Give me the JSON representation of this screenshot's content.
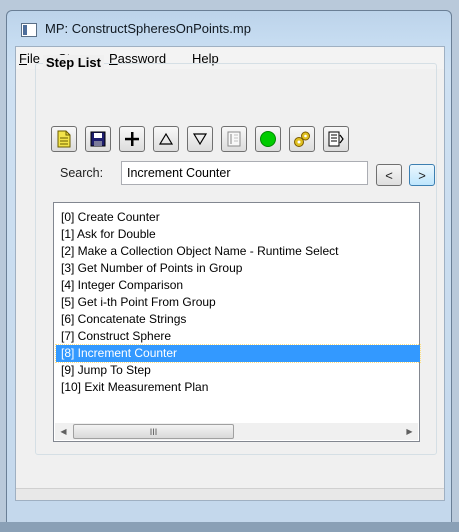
{
  "window": {
    "title": "MP: ConstructSpheresOnPoints.mp"
  },
  "menu": [
    {
      "accel": "F",
      "rest": "ile"
    },
    {
      "accel": "S",
      "rest": "tep"
    },
    {
      "accel": "P",
      "rest": "assword"
    },
    {
      "accel": "",
      "rest": "Help"
    }
  ],
  "step_list": {
    "group_label": "Step List",
    "toolbar": [
      {
        "name": "new-step-icon",
        "color": "#f2e34a"
      },
      {
        "name": "save-icon",
        "color": "#1e1e6e"
      },
      {
        "name": "add-icon",
        "color": "#000000"
      },
      {
        "name": "move-up-icon",
        "color": "#000000"
      },
      {
        "name": "move-down-icon",
        "color": "#000000"
      },
      {
        "name": "notes-icon",
        "color": "#bfbfbf"
      },
      {
        "name": "run-icon",
        "color": "#00cc00"
      },
      {
        "name": "gears-icon",
        "color": "#e0c020"
      },
      {
        "name": "properties-icon",
        "color": "#000000"
      }
    ],
    "search": {
      "label": "Search:",
      "value": "Increment Counter",
      "prev_label": "<",
      "next_label": ">"
    },
    "items": [
      "[0] Create Counter",
      "[1] Ask for Double",
      "[2] Make a Collection Object Name - Runtime Select",
      "[3] Get Number of Points in Group",
      "[4] Integer Comparison",
      "[5] Get i-th Point From Group",
      "[6] Concatenate Strings",
      "[7] Construct Sphere",
      "[8] Increment Counter",
      "[9] Jump To Step",
      "[10] Exit Measurement Plan"
    ],
    "selected_index": 8,
    "scrollbar": {
      "left_arrow": "◀",
      "right_arrow": "▶",
      "grip": "III"
    }
  },
  "colors": {
    "selection": "#3399ff",
    "title_gradient": "#c6dcf1"
  }
}
